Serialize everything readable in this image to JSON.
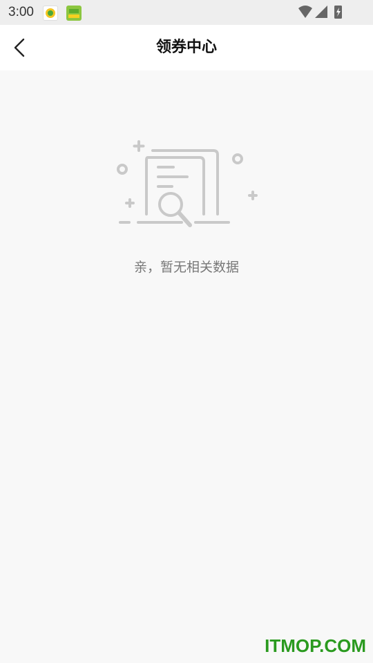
{
  "status_bar": {
    "time": "3:00",
    "icons": [
      "app-notification-icon",
      "app-notification-icon-2",
      "wifi-icon",
      "signal-icon",
      "battery-charging-icon"
    ]
  },
  "header": {
    "back_icon": "chevron-left-icon",
    "title": "领券中心"
  },
  "empty_state": {
    "illustration": "document-search-icon",
    "message": "亲，暂无相关数据"
  },
  "watermark": "ITMOP.COM"
}
